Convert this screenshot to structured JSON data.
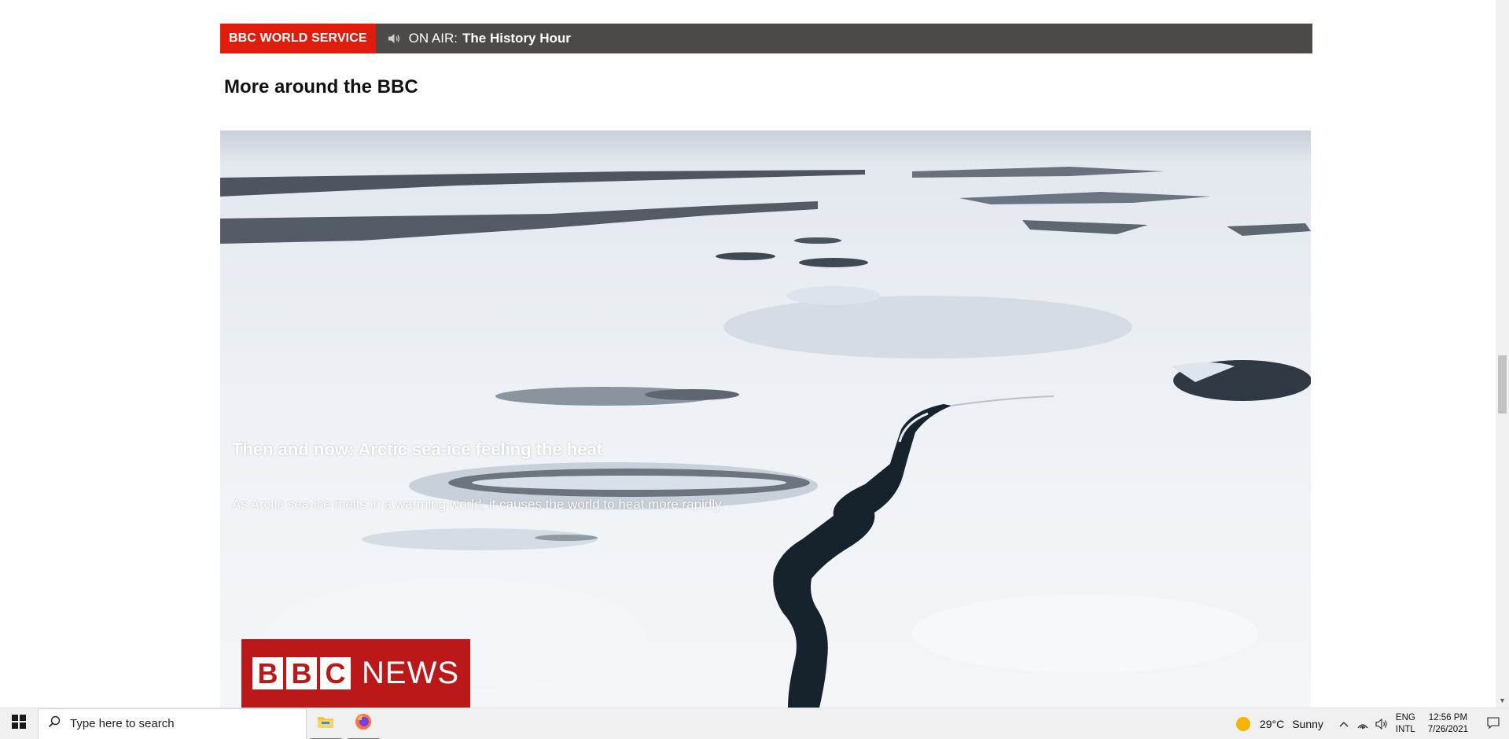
{
  "banner": {
    "service_label": "BBC WORLD SERVICE",
    "on_air_label": "ON AIR:",
    "program": "The History Hour",
    "colors": {
      "label_bg": "#e01d0d",
      "bar_bg": "#4d4946"
    }
  },
  "section": {
    "title": "More around the BBC"
  },
  "feature": {
    "title": "Then and now: Arctic sea-ice feeling the heat",
    "description": "As Arctic sea-ice melts in a warming world, it causes the world to heat more rapidly.",
    "logo": {
      "letters": [
        "B",
        "B",
        "C"
      ],
      "word": "NEWS",
      "color": "#bb1919"
    }
  },
  "taskbar": {
    "search_placeholder": "Type here to search",
    "apps": [
      {
        "name": "file-explorer-icon"
      },
      {
        "name": "firefox-icon"
      }
    ],
    "weather": {
      "temp": "29°C",
      "condition": "Sunny"
    },
    "language": {
      "code": "ENG",
      "layout": "INTL"
    },
    "clock": {
      "time": "12:56 PM",
      "date": "7/26/2021"
    }
  }
}
